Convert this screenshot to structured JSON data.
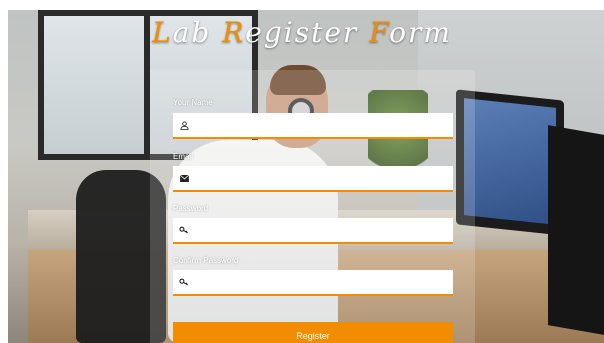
{
  "title": {
    "parts": [
      {
        "cap": "L",
        "rest": "ab"
      },
      {
        "cap": "R",
        "rest": "egister"
      },
      {
        "cap": "F",
        "rest": "orm"
      }
    ],
    "cap_color": "#f28c00"
  },
  "form": {
    "fields": [
      {
        "label": "Your Name",
        "icon": "user-icon",
        "value": "",
        "placeholder": ""
      },
      {
        "label": "Email",
        "icon": "envelope-icon",
        "value": "",
        "placeholder": ""
      },
      {
        "label": "Password",
        "icon": "key-icon",
        "value": "",
        "placeholder": ""
      },
      {
        "label": "Confirm Password",
        "icon": "key-icon",
        "value": "",
        "placeholder": ""
      }
    ],
    "submit_label": "Register",
    "accent": "#f28c00"
  }
}
